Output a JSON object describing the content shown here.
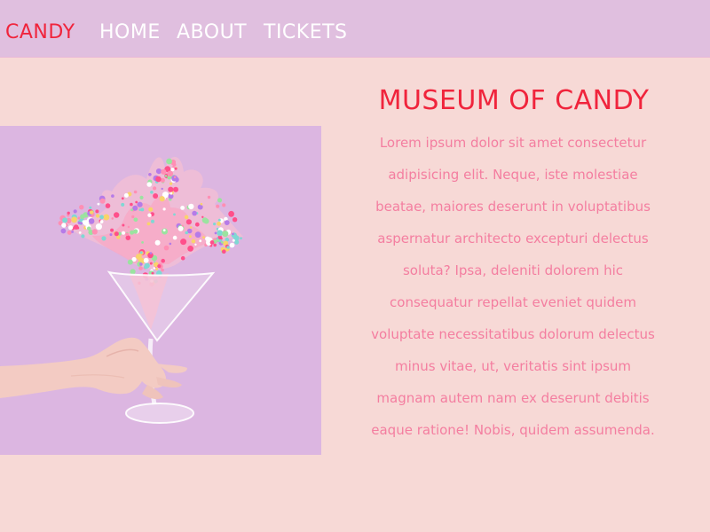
{
  "nav": {
    "brand": "CANDY",
    "items": [
      "HOME",
      "ABOUT",
      "TICKETS"
    ]
  },
  "content": {
    "title": "MUSEUM OF CANDY",
    "paragraph": "Lorem ipsum dolor sit amet consectetur adipisicing elit. Neque, iste molestiae beatae, maiores deserunt in voluptatibus aspernatur architecto excepturi delectus soluta? Ipsa, deleniti dolorem hic consequatur repellat eveniet quidem voluptate necessitatibus dolorum delectus minus vitae, ut, veritatis sint ipsum magnam autem nam ex deserunt debitis eaque ratione! Nobis, quidem assumenda."
  },
  "image": {
    "subject": "hand holding martini glass with exploding candy sprinkles"
  },
  "colors": {
    "nav_background": "#e0bfdf",
    "page_background": "#f7d9d6",
    "accent": "#f0243c",
    "body_text": "#f47ea0",
    "image_background": "#dcb6e1"
  }
}
